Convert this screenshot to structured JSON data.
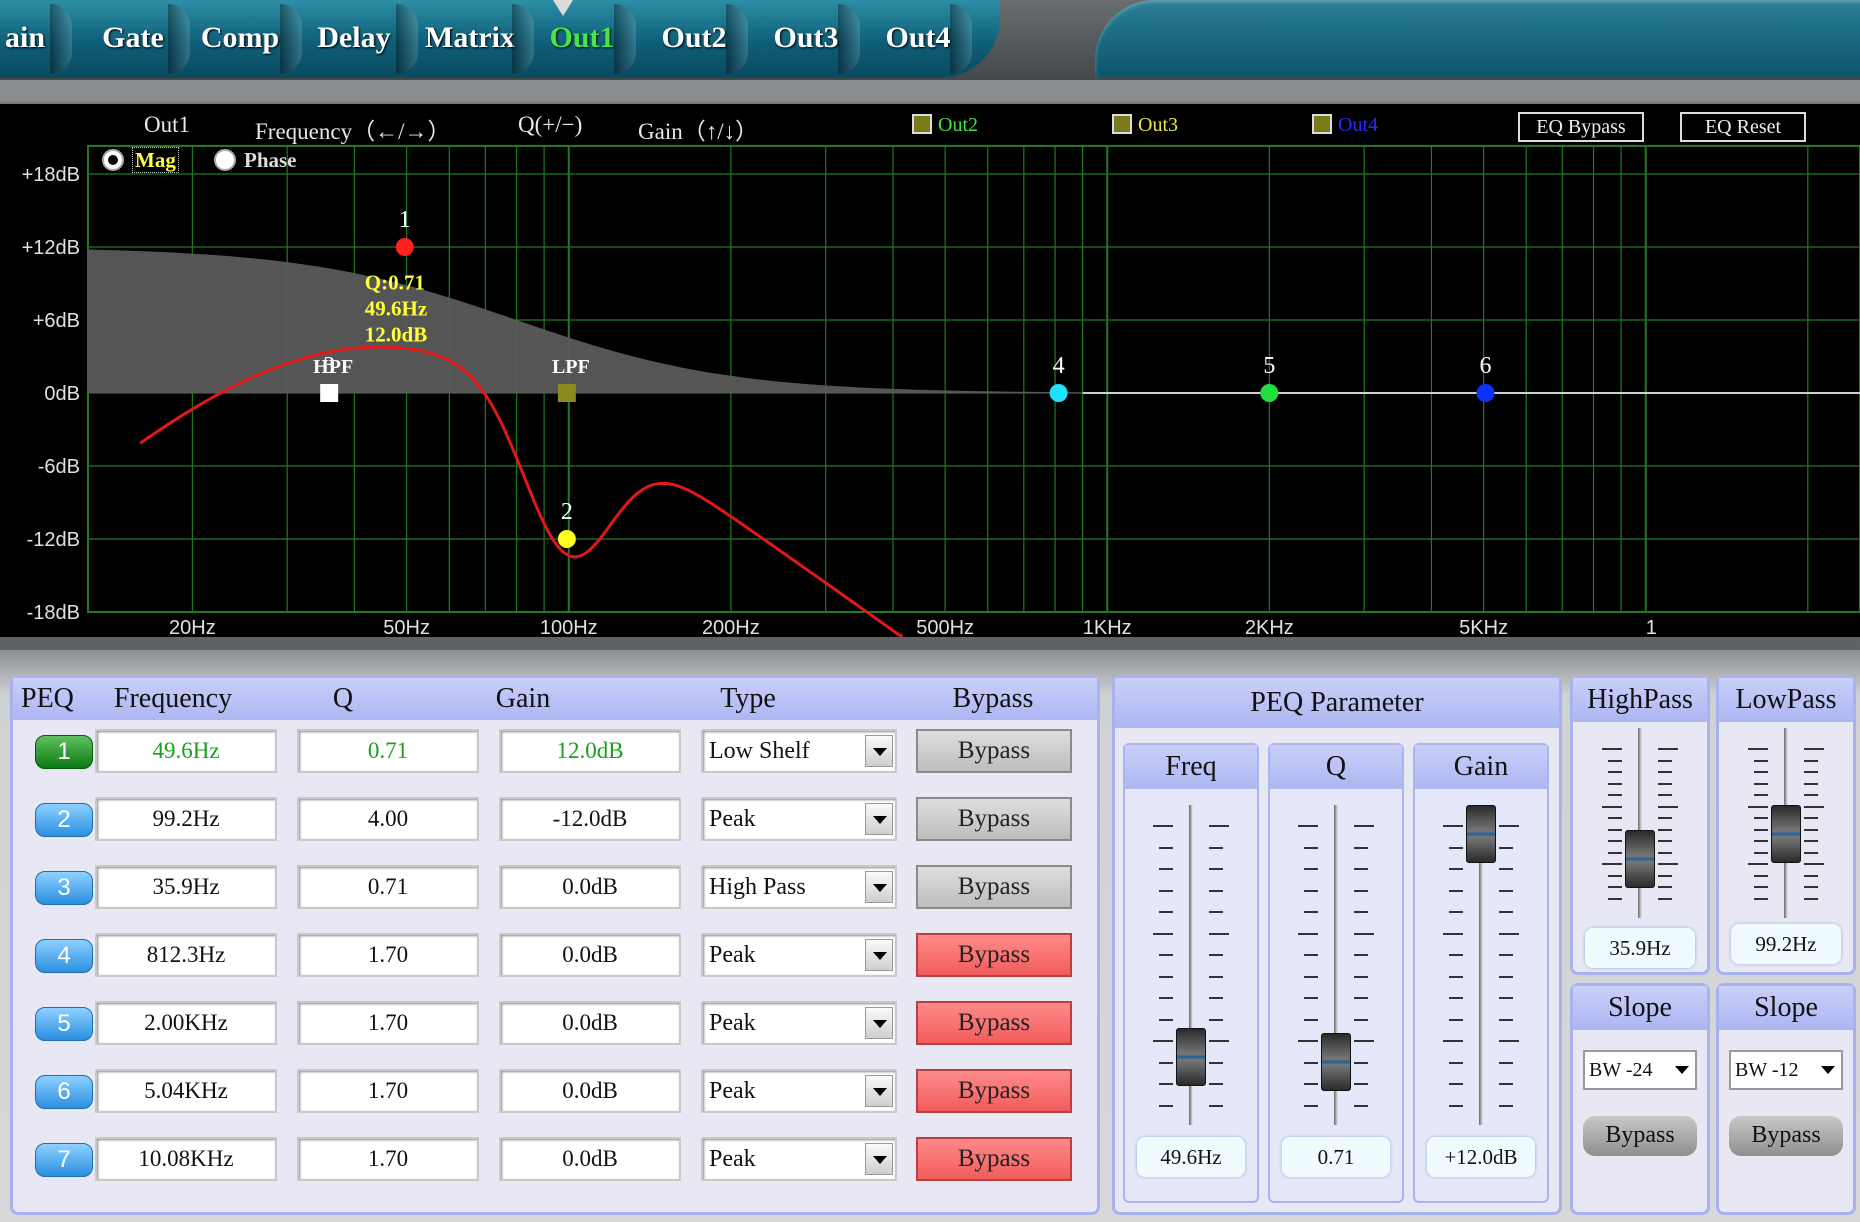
{
  "tabs": [
    "ain",
    "Gate",
    "Comp",
    "Delay",
    "Matrix",
    "Out1",
    "Out2",
    "Out3",
    "Out4"
  ],
  "active_tab": "Out1",
  "graph": {
    "channel": "Out1",
    "hint_frequency": "Frequency（←/→）",
    "hint_q": "Q(+/−)",
    "hint_gain": "Gain（↑/↓）",
    "outputs": [
      {
        "label": "Out2",
        "color": "#3ee63e"
      },
      {
        "label": "Out3",
        "color": "#e8e83a"
      },
      {
        "label": "Out4",
        "color": "#2a2aff"
      }
    ],
    "eq_bypass": "EQ Bypass",
    "eq_reset": "EQ Reset",
    "mag_label": "Mag",
    "phase_label": "Phase",
    "y_labels": [
      "+18dB",
      "+12dB",
      "+6dB",
      "0dB",
      "-6dB",
      "-12dB",
      "-18dB"
    ],
    "x_labels": [
      "20Hz",
      "50Hz",
      "100Hz",
      "200Hz",
      "500Hz",
      "1KHz",
      "2KHz",
      "5KHz",
      "1"
    ],
    "markers": [
      {
        "label": "1",
        "color": "#ff2020"
      },
      {
        "label": "2",
        "color": "#ffff20"
      },
      {
        "label": "3",
        "color": "#ffffff"
      },
      {
        "label": "4",
        "color": "#20e0ff"
      },
      {
        "label": "5",
        "color": "#20e040"
      },
      {
        "label": "6",
        "color": "#1030ff"
      }
    ],
    "hpf_label": "HPF",
    "lpf_label": "LPF",
    "readout": {
      "q": "Q:0.71",
      "freq": "49.6Hz",
      "gain": "12.0dB"
    },
    "colors": {
      "grid": "#1f7a22",
      "curve": "#e01818",
      "fill": "#5a5a5a"
    }
  },
  "peq": {
    "headers": {
      "peq": "PEQ",
      "frequency": "Frequency",
      "q": "Q",
      "gain": "Gain",
      "type": "Type",
      "bypass": "Bypass"
    },
    "rows": [
      {
        "num": "1",
        "freq": "49.6Hz",
        "q": "0.71",
        "gain": "12.0dB",
        "type": "Low Shelf",
        "bypass": "Bypass",
        "bypass_on": false,
        "selected": true
      },
      {
        "num": "2",
        "freq": "99.2Hz",
        "q": "4.00",
        "gain": "-12.0dB",
        "type": "Peak",
        "bypass": "Bypass",
        "bypass_on": false,
        "selected": false
      },
      {
        "num": "3",
        "freq": "35.9Hz",
        "q": "0.71",
        "gain": "0.0dB",
        "type": "High Pass",
        "bypass": "Bypass",
        "bypass_on": false,
        "selected": false
      },
      {
        "num": "4",
        "freq": "812.3Hz",
        "q": "1.70",
        "gain": "0.0dB",
        "type": "Peak",
        "bypass": "Bypass",
        "bypass_on": true,
        "selected": false
      },
      {
        "num": "5",
        "freq": "2.00KHz",
        "q": "1.70",
        "gain": "0.0dB",
        "type": "Peak",
        "bypass": "Bypass",
        "bypass_on": true,
        "selected": false
      },
      {
        "num": "6",
        "freq": "5.04KHz",
        "q": "1.70",
        "gain": "0.0dB",
        "type": "Peak",
        "bypass": "Bypass",
        "bypass_on": true,
        "selected": false
      },
      {
        "num": "7",
        "freq": "10.08KHz",
        "q": "1.70",
        "gain": "0.0dB",
        "type": "Peak",
        "bypass": "Bypass",
        "bypass_on": true,
        "selected": false
      }
    ]
  },
  "peq_param": {
    "title": "PEQ Parameter",
    "freq": {
      "label": "Freq",
      "value": "49.6Hz",
      "level": 0.15
    },
    "q": {
      "label": "Q",
      "value": "0.71",
      "level": 0.13
    },
    "gain": {
      "label": "Gain",
      "value": "+12.0dB",
      "level": 1.0
    }
  },
  "highpass": {
    "title": "HighPass",
    "value": "35.9Hz",
    "level": 0.23,
    "slope_title": "Slope",
    "slope": "BW -24",
    "bypass": "Bypass"
  },
  "lowpass": {
    "title": "LowPass",
    "value": "99.2Hz",
    "level": 0.42,
    "slope_title": "Slope",
    "slope": "BW -12",
    "bypass": "Bypass"
  }
}
